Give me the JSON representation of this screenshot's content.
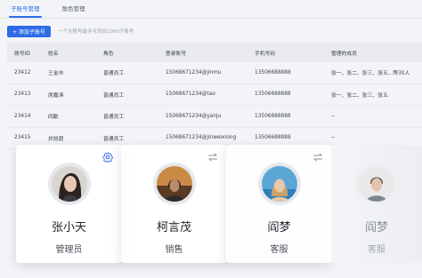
{
  "tabs": [
    {
      "label": "子账号管理",
      "active": true
    },
    {
      "label": "角色管理",
      "active": false
    }
  ],
  "toolbar": {
    "add_label": "+ 添加子账号",
    "hint": "一个主账号最多可添加1000子账号"
  },
  "table": {
    "columns": [
      "账号ID",
      "姓名",
      "角色",
      "登录账号",
      "手机号码",
      "管理的成员"
    ],
    "rows": [
      [
        "23412",
        "王金市",
        "普通员工",
        "15068671234@jinmu",
        "13506688888",
        "张一、张二、张三、张五...等30人"
      ],
      [
        "23413",
        "席嘉涛",
        "普通员工",
        "15068671234@tao",
        "13506688888",
        "张一、张二、张三、张五"
      ],
      [
        "23414",
        "阎勤",
        "普通员工",
        "15068671234@yanju",
        "13506688888",
        "--"
      ],
      [
        "23415",
        "井旭超",
        "普通员工",
        "15068671234@jinweixiong",
        "13506688888",
        "--"
      ]
    ]
  },
  "cards": [
    {
      "name": "张小天",
      "role": "管理员",
      "corner_icon": "gear-icon"
    },
    {
      "name": "柯言茂",
      "role": "销售",
      "corner_icon": "swap-icon"
    },
    {
      "name": "阎梦",
      "role": "客服",
      "corner_icon": "swap-icon"
    },
    {
      "name": "阎梦",
      "role": "客服",
      "corner_icon": ""
    }
  ],
  "colors": {
    "accent": "#2e6be6",
    "header_bg": "#e9ebf0"
  }
}
